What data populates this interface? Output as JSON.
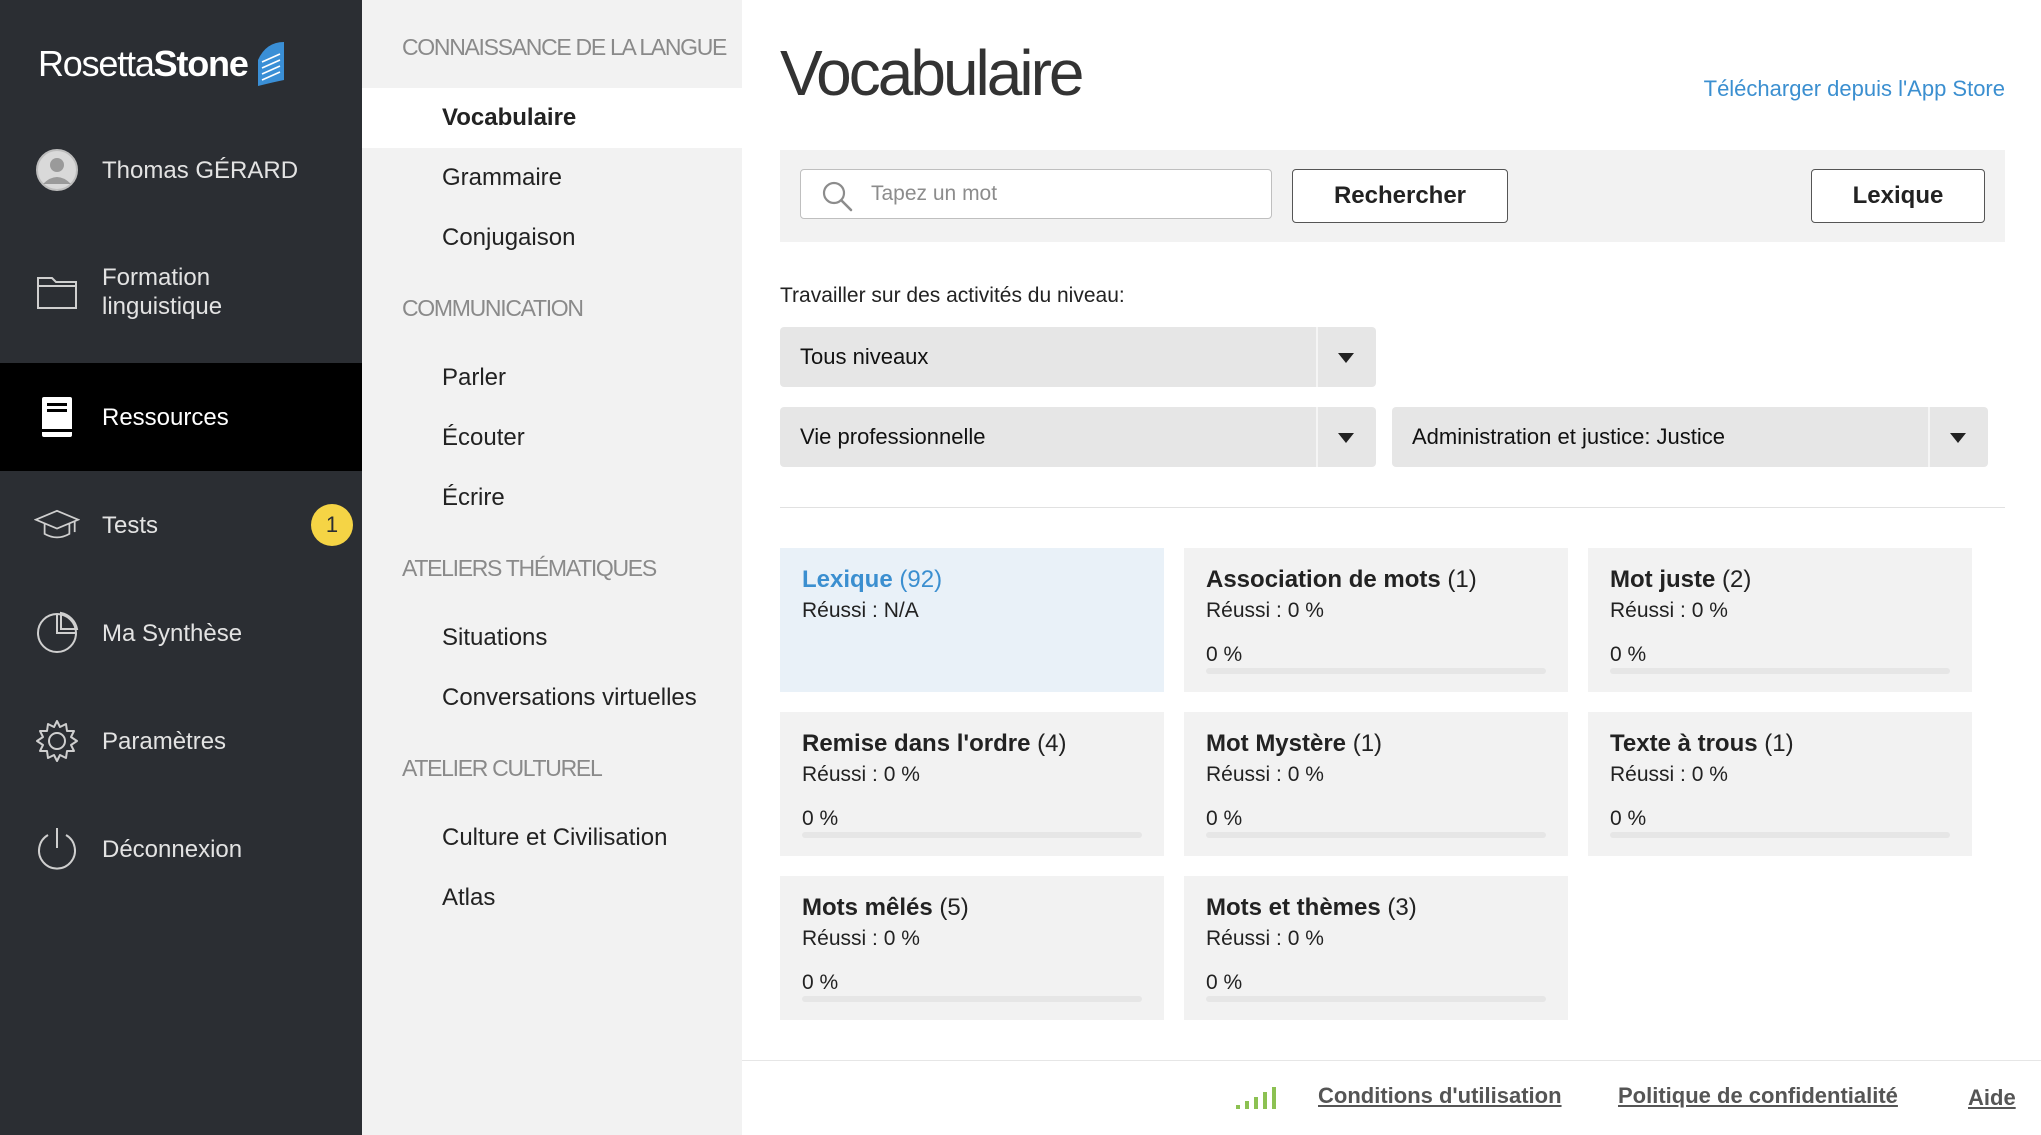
{
  "sidebar": {
    "logo": {
      "word1": "Rosetta",
      "word2": "Stone",
      "mark": "rosetta-stone-mark"
    },
    "user": {
      "name": "Thomas GÉRARD",
      "icon": "user-avatar-icon"
    },
    "items": [
      {
        "label": "Formation linguistique",
        "icon": "folder-icon",
        "active": false
      },
      {
        "label": "Ressources",
        "icon": "book-icon",
        "active": true
      },
      {
        "label": "Tests",
        "icon": "graduation-cap-icon",
        "badge": "1",
        "active": false
      },
      {
        "label": "Ma Synthèse",
        "icon": "pie-chart-icon",
        "active": false
      },
      {
        "label": "Paramètres",
        "icon": "gear-icon",
        "active": false
      },
      {
        "label": "Déconnexion",
        "icon": "power-icon",
        "active": false
      }
    ],
    "badge_color": "#f5d445"
  },
  "submenu": {
    "sections": [
      {
        "heading": "CONNAISSANCE DE LA LANGUE",
        "items": [
          "Vocabulaire",
          "Grammaire",
          "Conjugaison"
        ]
      },
      {
        "heading": "COMMUNICATION",
        "items": [
          "Parler",
          "Écouter",
          "Écrire"
        ]
      },
      {
        "heading": "ATELIERS THÉMATIQUES",
        "items": [
          "Situations",
          "Conversations virtuelles"
        ]
      },
      {
        "heading": "ATELIER CULTUREL",
        "items": [
          "Culture et Civilisation",
          "Atlas"
        ]
      }
    ],
    "active_item": "Vocabulaire"
  },
  "main": {
    "title": "Vocabulaire",
    "app_store_link": "Télécharger depuis l'App Store",
    "search": {
      "placeholder": "Tapez un mot",
      "value": "",
      "button": "Rechercher",
      "lexique_button": "Lexique"
    },
    "level_label": "Travailler sur des activités du niveau:",
    "selects": {
      "level": "Tous niveaux",
      "theme": "Vie professionnelle",
      "subtheme": "Administration et justice: Justice"
    },
    "cards": [
      {
        "name": "Lexique",
        "count": "(92)",
        "success": "Réussi : N/A",
        "percent": null,
        "percent_label": "",
        "selected": true
      },
      {
        "name": "Association de mots",
        "count": "(1)",
        "success": "Réussi : 0 %",
        "percent": 0,
        "percent_label": "0 %",
        "selected": false
      },
      {
        "name": "Mot juste",
        "count": "(2)",
        "success": "Réussi : 0 %",
        "percent": 0,
        "percent_label": "0 %",
        "selected": false
      },
      {
        "name": "Remise dans l'ordre",
        "count": "(4)",
        "success": "Réussi : 0 %",
        "percent": 0,
        "percent_label": "0 %",
        "selected": false
      },
      {
        "name": "Mot Mystère",
        "count": "(1)",
        "success": "Réussi : 0 %",
        "percent": 0,
        "percent_label": "0 %",
        "selected": false
      },
      {
        "name": "Texte à trous",
        "count": "(1)",
        "success": "Réussi : 0 %",
        "percent": 0,
        "percent_label": "0 %",
        "selected": false
      },
      {
        "name": "Mots mêlés",
        "count": "(5)",
        "success": "Réussi : 0 %",
        "percent": 0,
        "percent_label": "0 %",
        "selected": false
      },
      {
        "name": "Mots et thèmes",
        "count": "(3)",
        "success": "Réussi : 0 %",
        "percent": 0,
        "percent_label": "0 %",
        "selected": false
      }
    ],
    "accent_color": "#3b8fd0"
  },
  "footer": {
    "signal_icon": "signal-strength-icon",
    "terms": "Conditions d'utilisation",
    "privacy": "Politique de confidentialité",
    "help": "Aide"
  }
}
